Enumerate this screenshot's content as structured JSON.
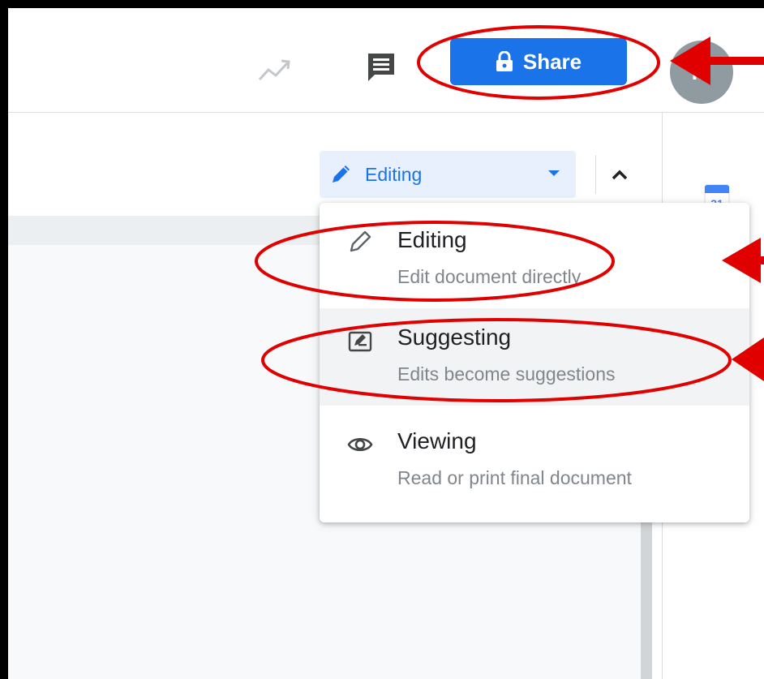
{
  "header": {
    "share_label": "Share",
    "avatar_initial": "M"
  },
  "toolbar": {
    "mode_label": "Editing"
  },
  "menu": {
    "items": [
      {
        "title": "Editing",
        "description": "Edit document directly",
        "icon": "pencil-icon"
      },
      {
        "title": "Suggesting",
        "description": "Edits become suggestions",
        "icon": "suggest-icon"
      },
      {
        "title": "Viewing",
        "description": "Read or print final document",
        "icon": "eye-icon"
      }
    ]
  },
  "calendar": {
    "day": "31"
  },
  "colors": {
    "accent": "#1a73e8",
    "annotation": "#e00000",
    "hover_background": "#f1f3f4"
  }
}
